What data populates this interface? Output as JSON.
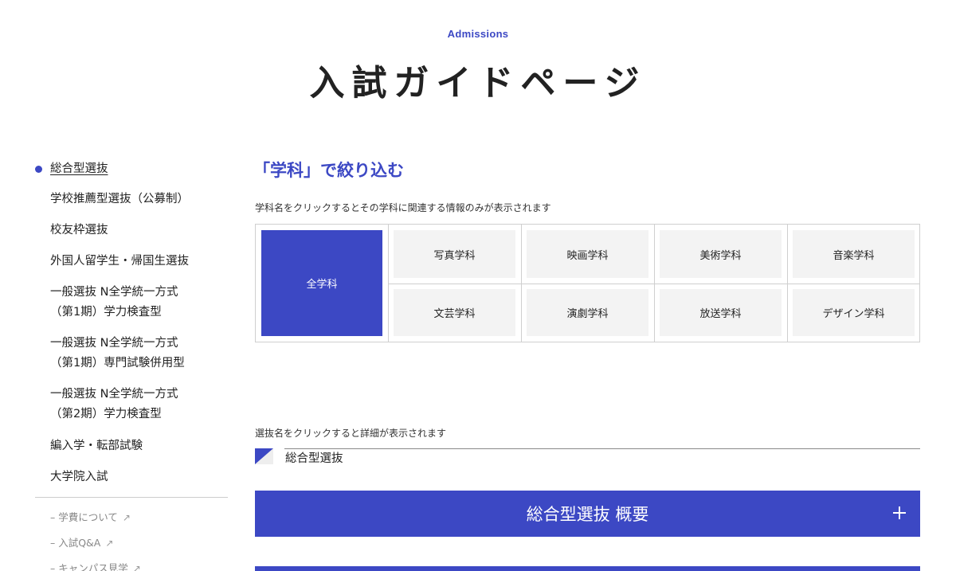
{
  "header": {
    "eyebrow": "Admissions",
    "title": "入試ガイドページ"
  },
  "sidebar": {
    "items": [
      {
        "label": "総合型選抜",
        "active": true
      },
      {
        "label": "学校推薦型選抜（公募制）"
      },
      {
        "label": "校友枠選抜"
      },
      {
        "label": "外国人留学生・帰国生選抜"
      },
      {
        "label": "一般選抜 N全学統一方式",
        "label2": "（第1期）学力検査型"
      },
      {
        "label": "一般選抜 N全学統一方式",
        "label2": "（第1期）専門試験併用型"
      },
      {
        "label": "一般選抜 N全学統一方式",
        "label2": "（第2期）学力検査型"
      },
      {
        "label": "編入学・転部試験"
      },
      {
        "label": "大学院入試"
      }
    ],
    "links": [
      {
        "label": "– 学費について",
        "icon": "external-link-icon"
      },
      {
        "label": "– 入試Q&A",
        "icon": "external-link-icon"
      },
      {
        "label": "– キャンパス見学",
        "icon": "external-link-icon"
      }
    ]
  },
  "filter": {
    "heading": "「学科」で絞り込む",
    "note": "学科名をクリックするとその学科に関連する情報のみが表示されます",
    "departments": {
      "all": "全学科",
      "row1": [
        "写真学科",
        "映画学科",
        "美術学科",
        "音楽学科"
      ],
      "row2": [
        "文芸学科",
        "演劇学科",
        "放送学科",
        "デザイン学科"
      ]
    }
  },
  "selection": {
    "note": "選抜名をクリックすると詳細が表示されます",
    "current": "総合型選抜"
  },
  "accordion": {
    "label": "総合型選抜 概要",
    "icon": "plus-icon"
  },
  "colors": {
    "accent": "#3c48c4",
    "cell_bg": "#f3f3f3",
    "border": "#cfcfcf"
  }
}
